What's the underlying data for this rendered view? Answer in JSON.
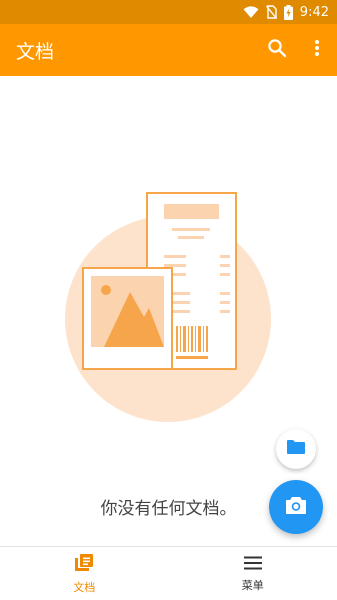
{
  "status_bar": {
    "time": "9:42",
    "icons": [
      "wifi-icon",
      "no-sim-icon",
      "battery-charging-icon"
    ]
  },
  "app_bar": {
    "title": "文档",
    "icons": [
      "search-icon",
      "more-vert-icon"
    ]
  },
  "empty_state": {
    "message": "你没有任何文档。"
  },
  "fabs": {
    "secondary_icon": "folder-icon",
    "primary_icon": "camera-icon"
  },
  "bottom_nav": {
    "items": [
      {
        "label": "文档",
        "icon": "document-icon",
        "active": true
      },
      {
        "label": "菜单",
        "icon": "menu-icon",
        "active": false
      }
    ]
  },
  "colors": {
    "status_bar": "#e08a00",
    "primary": "#ff9800",
    "accent": "#2196f3",
    "illustration_circle": "#fde3cc"
  }
}
